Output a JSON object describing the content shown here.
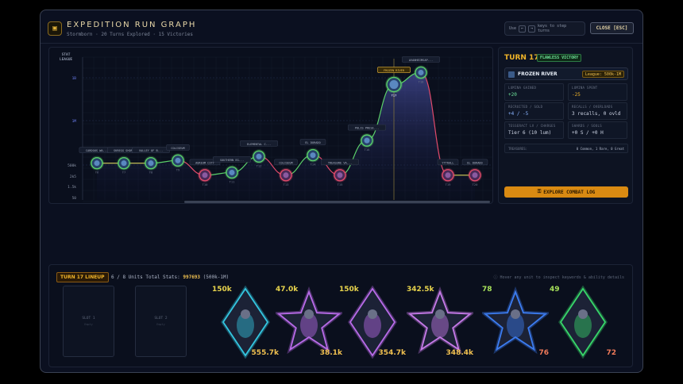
{
  "app": {
    "title": "EXPEDITION RUN GRAPH",
    "subtitle": "Stormborn · 20 Turns Explored · 15 Victories",
    "keys_prefix": "Use",
    "key_left": "←",
    "key_right": "→",
    "keys_suffix": "keys to step turns",
    "close_label": "CLOSE [ESC]"
  },
  "chart_data": {
    "type": "line",
    "yaxis_title_1": "STAT",
    "yaxis_title_2": "LEAGUE",
    "y_ticks": [
      "1B",
      "1M",
      "500k",
      "2k5",
      "1.5k",
      "50"
    ],
    "nodes": [
      {
        "turn": "T6",
        "label": "CARDOUS WA...",
        "result": "win",
        "level": 0.24
      },
      {
        "turn": "T7",
        "label": "SKREGG SHORE",
        "result": "win",
        "level": 0.24
      },
      {
        "turn": "T8",
        "label": "VALLEY OF B...",
        "result": "win",
        "level": 0.24
      },
      {
        "turn": "T9",
        "label": "COLISEUM",
        "result": "win",
        "level": 0.26
      },
      {
        "turn": "T10",
        "label": "AUREUM CITY",
        "result": "loss",
        "level": 0.15
      },
      {
        "turn": "T11",
        "label": "SOUTHERN EG...",
        "result": "win",
        "level": 0.17
      },
      {
        "turn": "T12",
        "label": "ELEMENTAL C...",
        "result": "win",
        "level": 0.29
      },
      {
        "turn": "T13",
        "label": "COLISEUM",
        "result": "loss",
        "level": 0.15
      },
      {
        "turn": "T14",
        "label": "EL DORADO",
        "result": "win",
        "level": 0.3
      },
      {
        "turn": "T15",
        "label": "TREASURE VA...",
        "result": "loss",
        "level": 0.15
      },
      {
        "turn": "T16",
        "label": "POLIS PRESE...",
        "result": "win",
        "level": 0.41
      },
      {
        "turn": "T17",
        "label": "FROZEN RIVER",
        "result": "win",
        "level": 0.83
      },
      {
        "turn": "T18",
        "label": "AVANHEIMSAP...",
        "result": "win",
        "level": 0.92
      },
      {
        "turn": "T19",
        "label": "YTTRALL",
        "result": "loss",
        "level": 0.15
      },
      {
        "turn": "T20",
        "label": "EL DORADO",
        "result": "loss",
        "level": 0.15
      }
    ],
    "selected_turn": "T17"
  },
  "turn": {
    "heading": "TURN 17",
    "badge": "FLAWLESS VICTORY",
    "location": "FROZEN RIVER",
    "league": "League: 500k-1M",
    "stats": [
      {
        "label": "LUMINA GAINED",
        "value": "+20",
        "color": "#6ee39a"
      },
      {
        "label": "LUMINA SPENT",
        "value": "-25",
        "color": "#f0b429"
      },
      {
        "label": "RECRUITED / SOLD",
        "value": "+4 / -5",
        "color": "#8ab4ff"
      },
      {
        "label": "RECALLS / OVERLOADS",
        "value": "3 recalls, 0 ovld",
        "color": "#cfd6e6"
      },
      {
        "label": "TESSERACT LV / CHARGES",
        "value": "Tier 6 (10 lum)",
        "color": "#cfd6e6"
      },
      {
        "label": "SHARDS / SOULS",
        "value": "+0 S / +0 H",
        "color": "#cfd6e6"
      }
    ],
    "treasures_label": "TREASURES:",
    "treasures_value": "0 Common, 1 Rare, 0 Great",
    "explore_label": "EXPLORE COMBAT LOG"
  },
  "lineup": {
    "tag": "TURN 17 LINEUP",
    "units_text": "6 / 8 Units",
    "total_label": "Total Stats:",
    "total_value": "997693",
    "total_range": "(500k-1M)",
    "hint": "Hover any unit to inspect keywords & ability details",
    "slots": [
      {
        "label": "SLOT 1",
        "desc": "Empty"
      },
      {
        "label": "SLOT 2",
        "desc": "Empty"
      }
    ],
    "units": [
      {
        "atk": "150k",
        "hp": "555.7k",
        "shape": "diamond",
        "glow": "#34c6e0",
        "atk_color": "#e8d44d",
        "hp_color": "#f0c050"
      },
      {
        "atk": "47.0k",
        "hp": "38.1k",
        "shape": "star",
        "glow": "#b86be8",
        "atk_color": "#e8d44d",
        "hp_color": "#f0c050"
      },
      {
        "atk": "150k",
        "hp": "354.7k",
        "shape": "diamond",
        "glow": "#b86be8",
        "atk_color": "#e8d44d",
        "hp_color": "#f0c050"
      },
      {
        "atk": "342.5k",
        "hp": "348.4k",
        "shape": "star",
        "glow": "#c67ae8",
        "atk_color": "#e8d44d",
        "hp_color": "#f0c050"
      },
      {
        "atk": "78",
        "hp": "76",
        "shape": "star",
        "glow": "#3c7cf0",
        "atk_color": "#a6e05a",
        "hp_color": "#f07a5a"
      },
      {
        "atk": "49",
        "hp": "72",
        "shape": "diamond",
        "glow": "#38d66a",
        "atk_color": "#a6e05a",
        "hp_color": "#f07a5a"
      }
    ]
  }
}
